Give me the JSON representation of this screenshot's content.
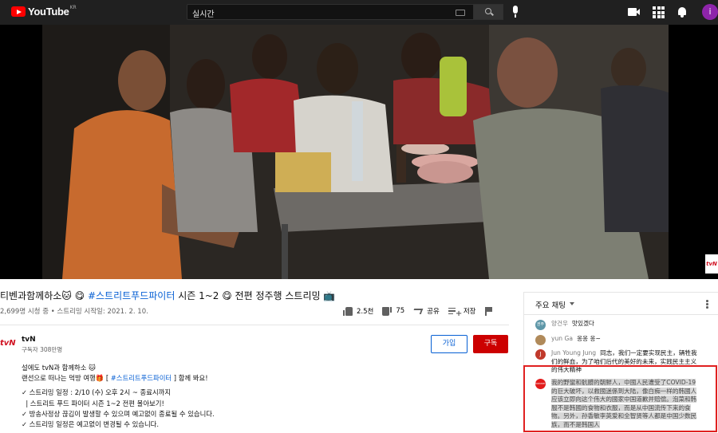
{
  "header": {
    "logo_text": "YouTube",
    "region": "KR",
    "search_value": "실시간",
    "avatar_letter": "i"
  },
  "video": {
    "watermark": "tvN"
  },
  "title": {
    "part1": "티벤과함께하소🐱",
    "part2": "😋 ",
    "hashtag": "#스트리트푸드파이터",
    "part3": " 시즌 1~2 😋 전편 정주행 스트리밍 📺"
  },
  "meta": {
    "line": "2,699명 시청 중 • 스트리밍 시작일: 2021. 2. 10."
  },
  "actions": {
    "like_count": "2.5천",
    "dislike_count": "75",
    "share_label": "공유",
    "save_label": "저장"
  },
  "channel": {
    "logo": "tvN",
    "name": "tvN",
    "subscribers": "구독자 308만명",
    "join_label": "가입",
    "subscribe_label": "구독"
  },
  "description": {
    "line1": "설에도 tvN과 함께하소 🐱",
    "line2_a": "랜선으로 떠나는 먹방 여행🎁 [ ",
    "line2_tag": "#스트리트푸드파이터",
    "line2_b": " ] 함께 봐요!",
    "line3": "✓ 스트리밍 일정 : 2/10 (수) 오후 2시 ~ 종료시까지",
    "line4": "  | 스트리트 푸드 파이터 시즌 1~2 전편 몰아보기!",
    "line5": "✓ 방송사정상 끊김이 발생할 수 있으며 예고없이 종료될 수 있습니다.",
    "line6": "✓ 스트리밍 일정은 예고없이 변경될 수 있습니다."
  },
  "chat": {
    "title": "주요 채팅",
    "messages": [
      {
        "avatar": "권주",
        "avatar_color": "#5e97a8",
        "author": "양건우",
        "text": "맛있겠다"
      },
      {
        "avatar": "",
        "avatar_color": "#b08a5a",
        "author": "yun Ga",
        "text": "옹옹 옹~"
      },
      {
        "avatar": "J",
        "avatar_color": "#c0392b",
        "author": "Jun Young Jung",
        "text": "同志，我们一定要实现民主，辆牲我们的鲜血，为了咱们后代的美好的未来，实践民主主义的伟大精神"
      },
      {
        "avatar": "banner",
        "avatar_color": "#e21b1b",
        "author": "",
        "text": "我的野蠻和骯髒的朝鮮人，中國人民遭受了COVID-19的巨大破坏，以救國迷係到大陆，像白痴一样的韩國人应该立即向这个伟大的國家中国道歉并赔偿。泡菜和韩服不是韩國的食物和衣服，而是从中国流传下来的食物。另外，孙香敏李英爱和全智贤等人都是中国少数民族，而不是韩国人"
      }
    ]
  }
}
